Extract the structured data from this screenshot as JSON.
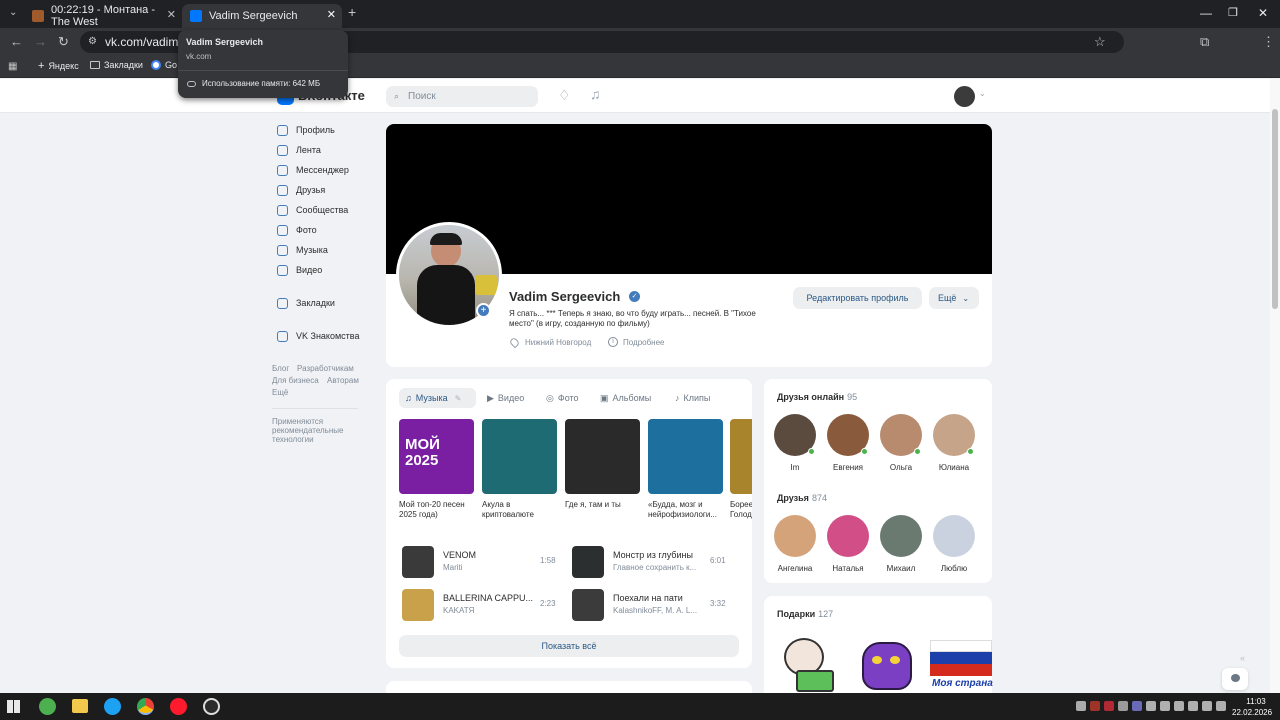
{
  "browser": {
    "tabs": [
      {
        "title": "00:22:19 - Монтана - The West"
      },
      {
        "title": "Vadim Sergeevich"
      }
    ],
    "new_tab_icon": "plus-icon",
    "url": "vk.com/vadim_ha",
    "bookmarks": [
      {
        "label": "Яндекс"
      },
      {
        "label": "Закладки"
      },
      {
        "label": "Go"
      }
    ],
    "tooltip": {
      "title": "Vadim Sergeevich",
      "domain": "vk.com",
      "memory": "Использование памяти: 642 МБ"
    }
  },
  "vk": {
    "logo": "ВКонтакте",
    "search_placeholder": "Поиск",
    "nav": [
      {
        "label": "Профиль",
        "icon": "profile-icon"
      },
      {
        "label": "Лента",
        "icon": "feed-icon"
      },
      {
        "label": "Мессенджер",
        "icon": "messenger-icon"
      },
      {
        "label": "Друзья",
        "icon": "friends-icon"
      },
      {
        "label": "Сообщества",
        "icon": "communities-icon"
      },
      {
        "label": "Фото",
        "icon": "photo-icon"
      },
      {
        "label": "Музыка",
        "icon": "music-icon"
      },
      {
        "label": "Видео",
        "icon": "video-icon"
      },
      {
        "label": "Закладки",
        "icon": "bookmark-icon"
      },
      {
        "label": "VK Знакомства",
        "icon": "dating-icon"
      }
    ],
    "footer_links": [
      "Блог",
      "Разработчикам",
      "Для бизнеса",
      "Авторам",
      "Ещё"
    ],
    "recommended_note": "Применяются рекомендательные технологии",
    "profile": {
      "name": "Vadim Sergeevich",
      "status": "Я спать... *** Теперь я знаю, во что буду играть... песней. В \"Тихое место\" (в игру, созданную по фильму)",
      "city": "Нижний Новгород",
      "details": "Подробнее",
      "edit_button": "Редактировать профиль",
      "more_button": "Ещё"
    },
    "media_tabs": [
      "Музыка",
      "Видео",
      "Фото",
      "Альбомы",
      "Клипы"
    ],
    "albums": [
      {
        "title": "Мой топ-20 песен 2025 года)",
        "cover_text": "МОЙ 2025",
        "color": "#7a1fa2"
      },
      {
        "title": "Акула в криптовалюте",
        "color": "#1f6b73"
      },
      {
        "title": "Где я, там и ты",
        "color": "#2a2a2a"
      },
      {
        "title": "«Будда, мозг и нейрофизиологи...",
        "color": "#1d6f9e"
      },
      {
        "title": "Борее Голод",
        "color": "#a8842c"
      }
    ],
    "tracks": [
      {
        "name": "VENOM",
        "artist": "Mariti",
        "duration": "1:58",
        "color": "#3a3a3a"
      },
      {
        "name": "Монстр из глубины",
        "artist": "Главное сохранить к...",
        "duration": "6:01",
        "color": "#2c2f2f"
      },
      {
        "name": "BALLERINA CAPPU...",
        "artist": "KAKATЯ",
        "duration": "2:23",
        "color": "#c9a14a"
      },
      {
        "name": "Поехали на пати",
        "artist": "KalashnikoFF, M. A. L...",
        "duration": "3:32",
        "color": "#3b3b3b"
      }
    ],
    "show_all": "Показать всё",
    "friends_online": {
      "title": "Друзья онлайн",
      "count": "95",
      "people": [
        {
          "name": "Im",
          "color": "#5b4a3e"
        },
        {
          "name": "Евгения",
          "color": "#8a5a3c"
        },
        {
          "name": "Ольга",
          "color": "#b88a6e"
        },
        {
          "name": "Юлиана",
          "color": "#c6a48a"
        }
      ]
    },
    "friends": {
      "title": "Друзья",
      "count": "874",
      "people": [
        {
          "name": "Ангелина",
          "color": "#d4a37a"
        },
        {
          "name": "Наталья",
          "color": "#d24e86"
        },
        {
          "name": "Михаил",
          "color": "#6a7a70"
        },
        {
          "name": "Люблю",
          "color": "#c9d2de"
        }
      ]
    },
    "gifts": {
      "title": "Подарки",
      "count": "127",
      "flag_caption": "Моя страна"
    }
  },
  "taskbar": {
    "time": "11:03",
    "date": "22.02.2026"
  }
}
